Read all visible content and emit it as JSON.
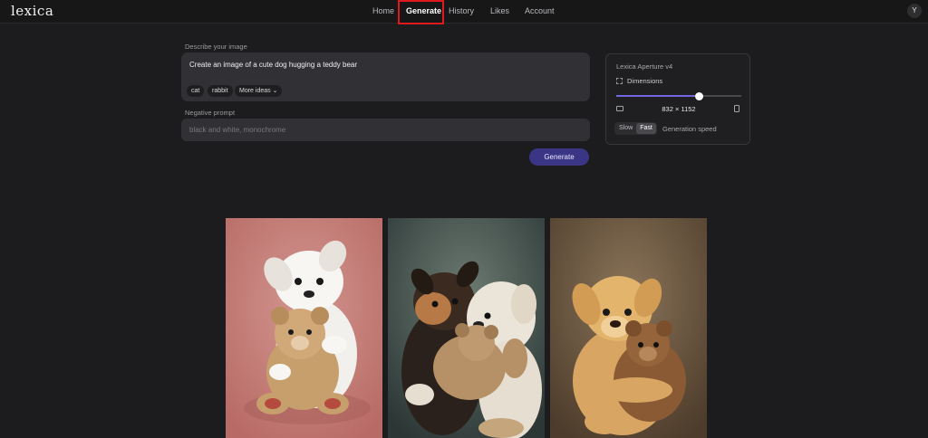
{
  "app": {
    "logo": "lexica"
  },
  "nav": {
    "items": [
      {
        "label": "Home"
      },
      {
        "label": "Generate"
      },
      {
        "label": "History"
      },
      {
        "label": "Likes"
      },
      {
        "label": "Account"
      }
    ],
    "active": "Generate",
    "avatar_initial": "Y"
  },
  "prompt": {
    "label": "Describe your image",
    "value": "Create an image of a cute dog hugging a teddy bear",
    "chips": [
      {
        "label": "cat"
      },
      {
        "label": "rabbit"
      },
      {
        "label": "More ideas ⌄"
      }
    ]
  },
  "negative": {
    "label": "Negative prompt",
    "placeholder": "black and white, monochrome"
  },
  "generate_label": "Generate",
  "settings": {
    "model": "Lexica Aperture v4",
    "dimensions_label": "Dimensions",
    "dimensions_value": "832 × 1152",
    "slider_fraction": 0.66,
    "speed_options": [
      {
        "label": "Slow"
      },
      {
        "label": "Fast"
      }
    ],
    "speed_selected": "Fast",
    "speed_label": "Generation speed"
  },
  "results": [
    {
      "subject": "white puppy hugging teddy bear",
      "background": "#c47f7a"
    },
    {
      "subject": "two puppies hugging teddy bear",
      "background": "#3a4a4a"
    },
    {
      "subject": "golden puppy hugging teddy bear",
      "background": "#6a5640"
    }
  ],
  "colors": {
    "accent": "#3b3586",
    "highlight_box": "#e0191f",
    "slider": "#6f66e0"
  }
}
